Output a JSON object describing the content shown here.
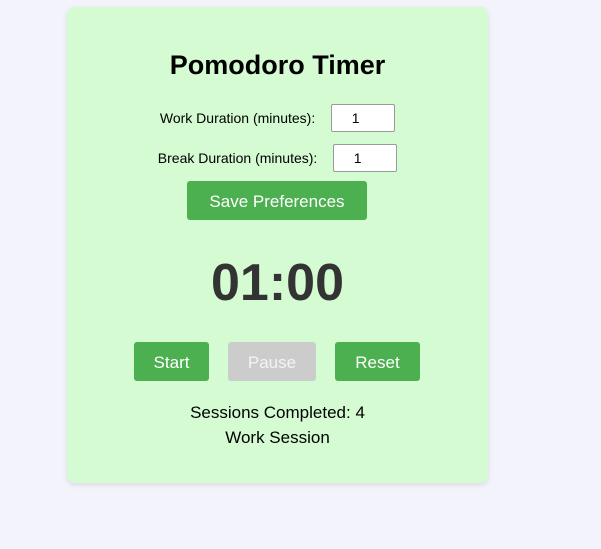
{
  "app": {
    "title": "Pomodoro Timer"
  },
  "preferences": {
    "work_label": "Work Duration (minutes):",
    "work_value": "1",
    "break_label": "Break Duration (minutes):",
    "break_value": "1",
    "save_label": "Save Preferences"
  },
  "timer": {
    "display": "01:00"
  },
  "controls": {
    "start_label": "Start",
    "pause_label": "Pause",
    "pause_disabled": true,
    "reset_label": "Reset"
  },
  "status": {
    "sessions_completed": "Sessions Completed: 4",
    "session_type": "Work Session"
  },
  "colors": {
    "page_background": "#f3f4fb",
    "card_background": "#d4fbd2",
    "button_green": "#4caf50",
    "button_disabled": "#cccccc",
    "timer_text": "#333333"
  }
}
